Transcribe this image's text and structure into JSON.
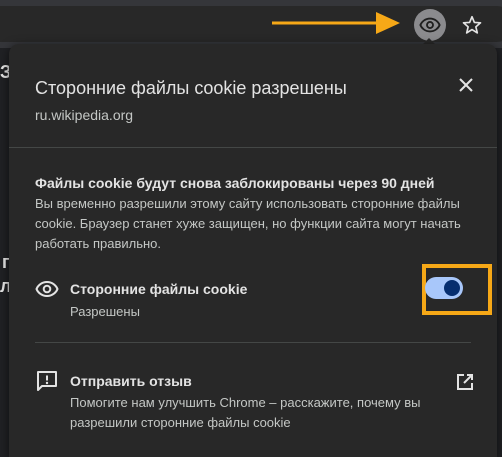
{
  "bubble": {
    "title": "Сторонние файлы cookie разрешены",
    "site": "ru.wikipedia.org",
    "close_icon": "close-icon"
  },
  "notice": {
    "title": "Файлы cookie будут снова заблокированы через 90 дней",
    "body": "Вы временно разрешили этому сайту использовать сторонние файлы cookie. Браузер станет хуже защищен, но функции сайта могут начать работать правильно."
  },
  "cookies_row": {
    "icon": "eye-icon",
    "title": "Сторонние файлы cookie",
    "status": "Разрешены",
    "toggle_on": true
  },
  "feedback_row": {
    "icon": "feedback-icon",
    "title": "Отправить отзыв",
    "description": "Помогите нам улучшить Chrome – расскажите, почему вы разрешили сторонние файлы cookie",
    "external_icon": "open-in-new-icon"
  },
  "toolbar": {
    "eye_icon": "eye-icon",
    "bookmark_icon": "star-icon"
  },
  "colors": {
    "accent_annotation": "#f6a817",
    "toggle_track": "#a8c7fa",
    "toggle_knob": "#062e6f",
    "bubble_bg": "#282828"
  }
}
